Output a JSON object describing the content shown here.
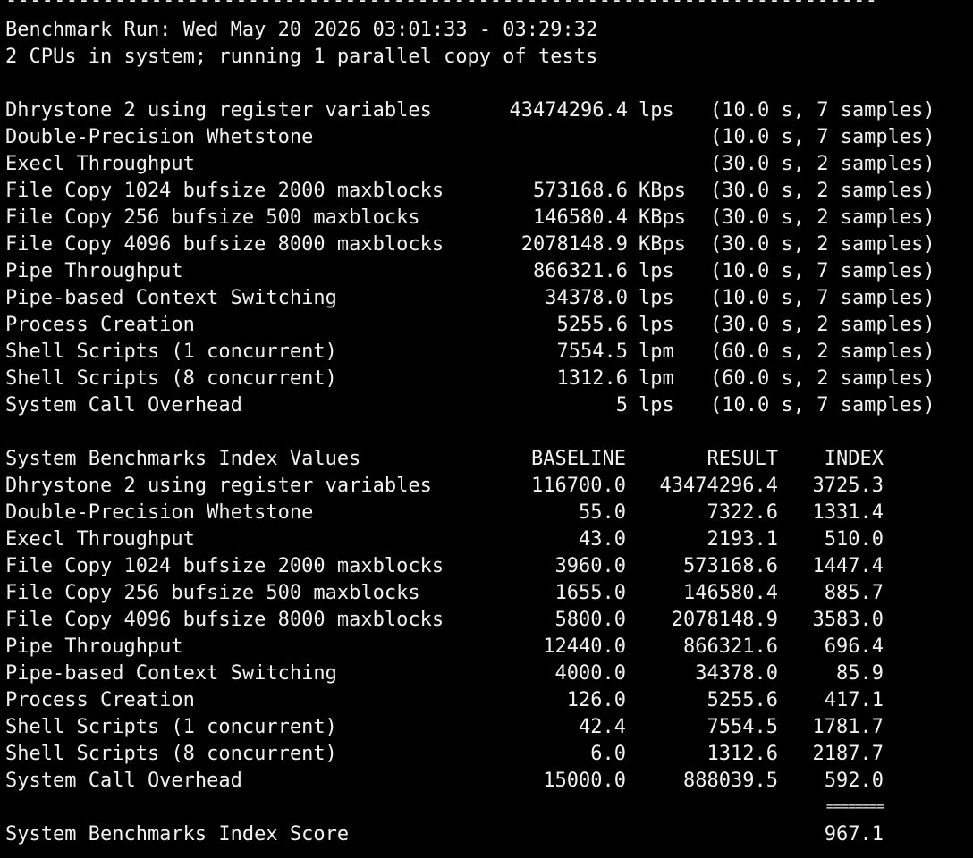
{
  "separator": "------------------------------------------------------------------------",
  "header": {
    "run_line": "Benchmark Run: Wed May 20 2026 03:01:33 - 03:29:32",
    "cpu_line": "2 CPUs in system; running 1 parallel copy of tests"
  },
  "results": [
    {
      "name": "Dhrystone 2 using register variables",
      "value": "43474296.4",
      "unit": "lps",
      "timing": "(10.0 s, 7 samples)"
    },
    {
      "name": "Double-Precision Whetstone",
      "value": "",
      "unit": "",
      "timing": "(10.0 s, 7 samples)"
    },
    {
      "name": "Execl Throughput",
      "value": "",
      "unit": "",
      "timing": "(30.0 s, 2 samples)"
    },
    {
      "name": "File Copy 1024 bufsize 2000 maxblocks",
      "value": "573168.6",
      "unit": "KBps",
      "timing": "(30.0 s, 2 samples)"
    },
    {
      "name": "File Copy 256 bufsize 500 maxblocks",
      "value": "146580.4",
      "unit": "KBps",
      "timing": "(30.0 s, 2 samples)"
    },
    {
      "name": "File Copy 4096 bufsize 8000 maxblocks",
      "value": "2078148.9",
      "unit": "KBps",
      "timing": "(30.0 s, 2 samples)"
    },
    {
      "name": "Pipe Throughput",
      "value": "866321.6",
      "unit": "lps",
      "timing": "(10.0 s, 7 samples)"
    },
    {
      "name": "Pipe-based Context Switching",
      "value": "34378.0",
      "unit": "lps",
      "timing": "(10.0 s, 7 samples)"
    },
    {
      "name": "Process Creation",
      "value": "5255.6",
      "unit": "lps",
      "timing": "(30.0 s, 2 samples)"
    },
    {
      "name": "Shell Scripts (1 concurrent)",
      "value": "7554.5",
      "unit": "lpm",
      "timing": "(60.0 s, 2 samples)"
    },
    {
      "name": "Shell Scripts (8 concurrent)",
      "value": "1312.6",
      "unit": "lpm",
      "timing": "(60.0 s, 2 samples)"
    },
    {
      "name": "System Call Overhead",
      "value": "5",
      "unit": "lps",
      "timing": "(10.0 s, 7 samples)"
    }
  ],
  "index_table": {
    "title": "System Benchmarks Index Values",
    "headers": {
      "baseline": "BASELINE",
      "result": "RESULT",
      "index": "INDEX"
    },
    "rows": [
      {
        "name": "Dhrystone 2 using register variables",
        "baseline": "116700.0",
        "result": "43474296.4",
        "index": "3725.3"
      },
      {
        "name": "Double-Precision Whetstone",
        "baseline": "55.0",
        "result": "7322.6",
        "index": "1331.4"
      },
      {
        "name": "Execl Throughput",
        "baseline": "43.0",
        "result": "2193.1",
        "index": "510.0"
      },
      {
        "name": "File Copy 1024 bufsize 2000 maxblocks",
        "baseline": "3960.0",
        "result": "573168.6",
        "index": "1447.4"
      },
      {
        "name": "File Copy 256 bufsize 500 maxblocks",
        "baseline": "1655.0",
        "result": "146580.4",
        "index": "885.7"
      },
      {
        "name": "File Copy 4096 bufsize 8000 maxblocks",
        "baseline": "5800.0",
        "result": "2078148.9",
        "index": "3583.0"
      },
      {
        "name": "Pipe Throughput",
        "baseline": "12440.0",
        "result": "866321.6",
        "index": "696.4"
      },
      {
        "name": "Pipe-based Context Switching",
        "baseline": "4000.0",
        "result": "34378.0",
        "index": "85.9"
      },
      {
        "name": "Process Creation",
        "baseline": "126.0",
        "result": "5255.6",
        "index": "417.1"
      },
      {
        "name": "Shell Scripts (1 concurrent)",
        "baseline": "42.4",
        "result": "7554.5",
        "index": "1781.7"
      },
      {
        "name": "Shell Scripts (8 concurrent)",
        "baseline": "6.0",
        "result": "1312.6",
        "index": "2187.7"
      },
      {
        "name": "System Call Overhead",
        "baseline": "15000.0",
        "result": "888039.5",
        "index": "592.0"
      }
    ],
    "score_separator": "========",
    "score_label": "System Benchmarks Index Score",
    "score_value": "967.1"
  },
  "colors": {
    "background": "#000000",
    "foreground": "#f2f2f2"
  }
}
